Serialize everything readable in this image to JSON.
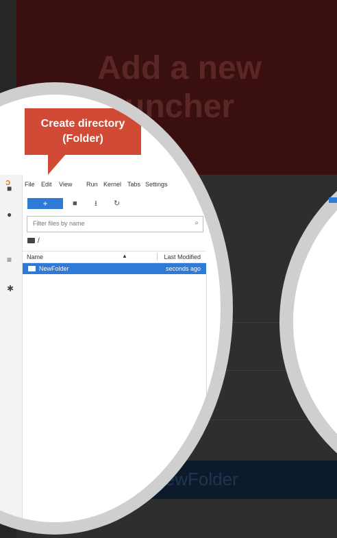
{
  "background": {
    "banner_title": "Add a new launcher",
    "bottom_text": "NewFolder"
  },
  "callout": {
    "line1": "Create directory",
    "line2": "(Folder)"
  },
  "menu": [
    "File",
    "Edit",
    "View",
    "Run",
    "Kernel",
    "Tabs",
    "Settings"
  ],
  "toolbar": {
    "new_label": "+",
    "icons": [
      "new-folder-icon",
      "upload-icon",
      "refresh-icon"
    ]
  },
  "filter": {
    "placeholder": "Filter files by name"
  },
  "path": {
    "label": "/"
  },
  "table": {
    "col_name": "Name",
    "col_modified": "Last Modified",
    "rows": [
      {
        "name": "NewFolder",
        "modified": "seconds ago"
      }
    ]
  },
  "rail_icons": [
    "folder-icon",
    "running-icon",
    "commands-icon",
    "extensions-icon"
  ],
  "colors": {
    "accent": "#2f7ad6",
    "callout": "#d04a35",
    "logo": "#e97a1f"
  }
}
